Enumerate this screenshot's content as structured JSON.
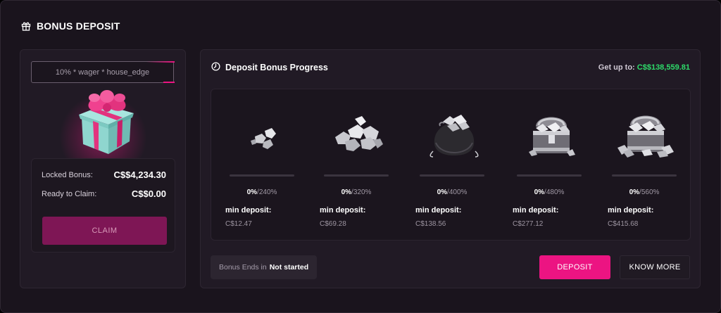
{
  "header": {
    "title": "BONUS DEPOSIT",
    "icon": "gift-icon"
  },
  "left_panel": {
    "formula": "10% * wager * house_edge",
    "locked_bonus_label": "Locked Bonus:",
    "locked_bonus_value": "C$$4,234.30",
    "ready_label": "Ready to Claim:",
    "ready_value": "C$$0.00",
    "claim_label": "CLAIM"
  },
  "progress": {
    "title": "Deposit Bonus Progress",
    "icon": "timer-icon",
    "get_up_label": "Get up to:",
    "get_up_value": "C$$138,559.81",
    "tiers": [
      {
        "progress": "0%",
        "target": "/240%",
        "progress_fraction": 0,
        "min_label": "min deposit:",
        "min_value": "C$12.47"
      },
      {
        "progress": "0%",
        "target": "/320%",
        "progress_fraction": 0,
        "min_label": "min deposit:",
        "min_value": "C$69.28"
      },
      {
        "progress": "0%",
        "target": "/400%",
        "progress_fraction": 0,
        "min_label": "min deposit:",
        "min_value": "C$138.56"
      },
      {
        "progress": "0%",
        "target": "/480%",
        "progress_fraction": 0,
        "min_label": "min deposit:",
        "min_value": "C$277.12"
      },
      {
        "progress": "0%",
        "target": "/560%",
        "progress_fraction": 0,
        "min_label": "min deposit:",
        "min_value": "C$415.68"
      }
    ],
    "ends_label": "Bonus Ends in",
    "ends_value": "Not started",
    "deposit_label": "DEPOSIT",
    "know_more_label": "KNOW MORE"
  },
  "colors": {
    "accent": "#ec1482",
    "green": "#2edb6a",
    "background": "#1a141d"
  }
}
